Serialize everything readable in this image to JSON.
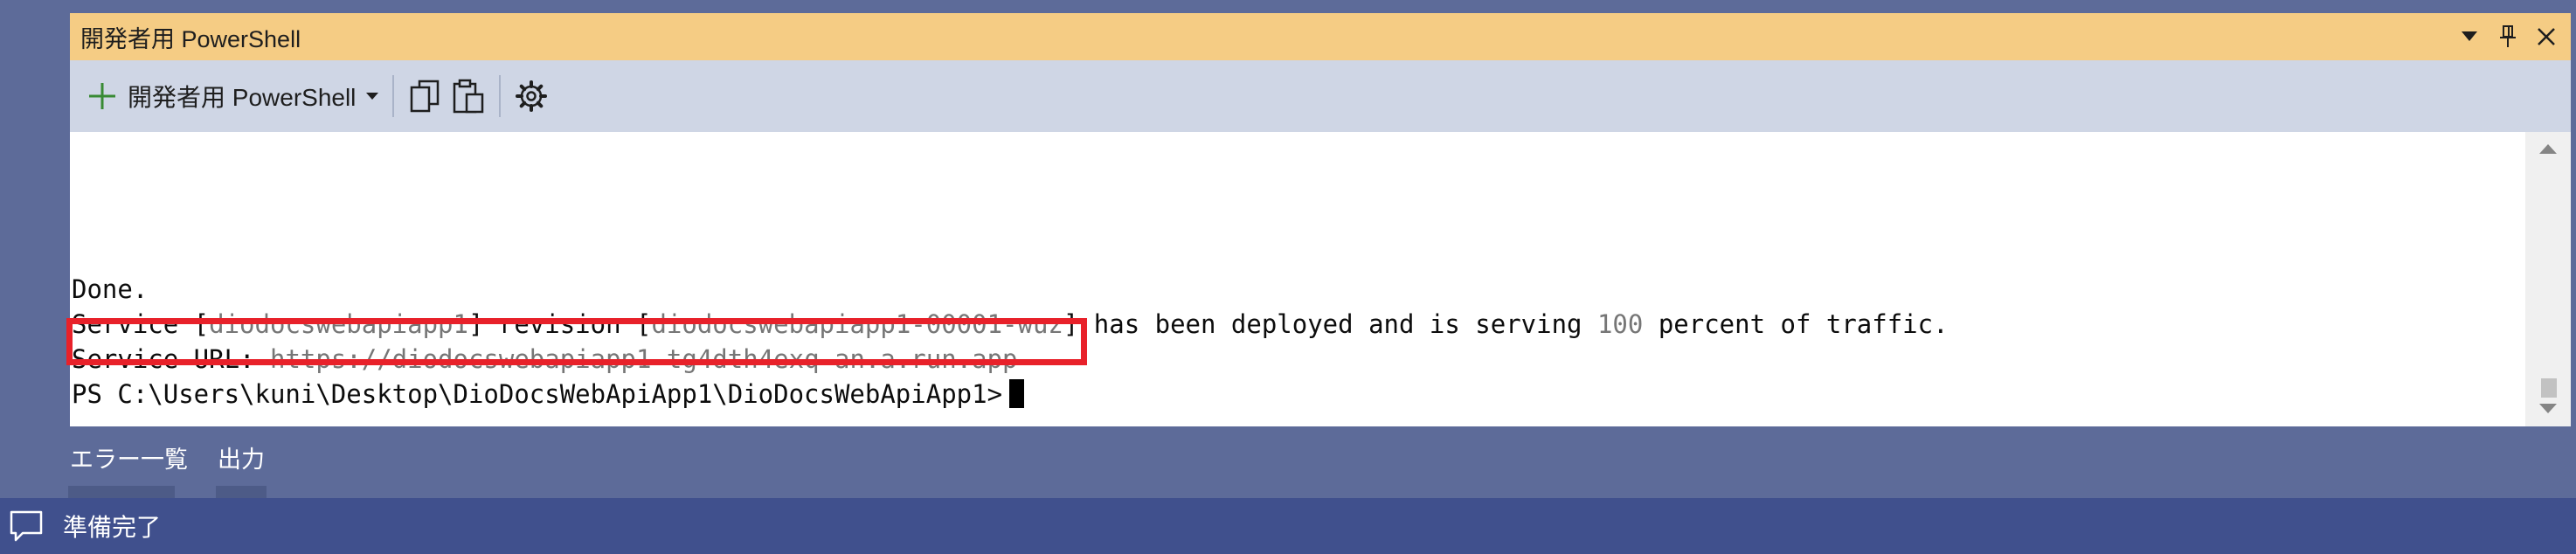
{
  "panel": {
    "title": "開発者用 PowerShell",
    "toolbar": {
      "new_terminal_label": "開発者用 PowerShell"
    }
  },
  "terminal": {
    "lines": {
      "done": "Done.",
      "l2_a": "Service [",
      "l2_service": "diodocswebapiapp1",
      "l2_b": "] revision [",
      "l2_revision": "diodocswebapiapp1-00001-wuz",
      "l2_c": "] has been deployed and is serving ",
      "l2_percent": "100",
      "l2_d": " percent of traffic.",
      "l3_label": "Service URL: ",
      "l3_url": "https://diodocswebapiapp1-tg4dth4exq-an.a.run.app",
      "prompt": "PS C:\\Users\\kuni\\Desktop\\DioDocsWebApiApp1\\DioDocsWebApiApp1>"
    }
  },
  "bottom_tabs": [
    {
      "label": "エラー一覧"
    },
    {
      "label": "出力"
    }
  ],
  "status": {
    "text": "準備完了"
  },
  "colors": {
    "title_bar": "#f5cc84",
    "toolbar": "#cfd6e5",
    "highlight": "#e8212a",
    "status_bar": "#40508d",
    "background": "#5d6b99"
  }
}
